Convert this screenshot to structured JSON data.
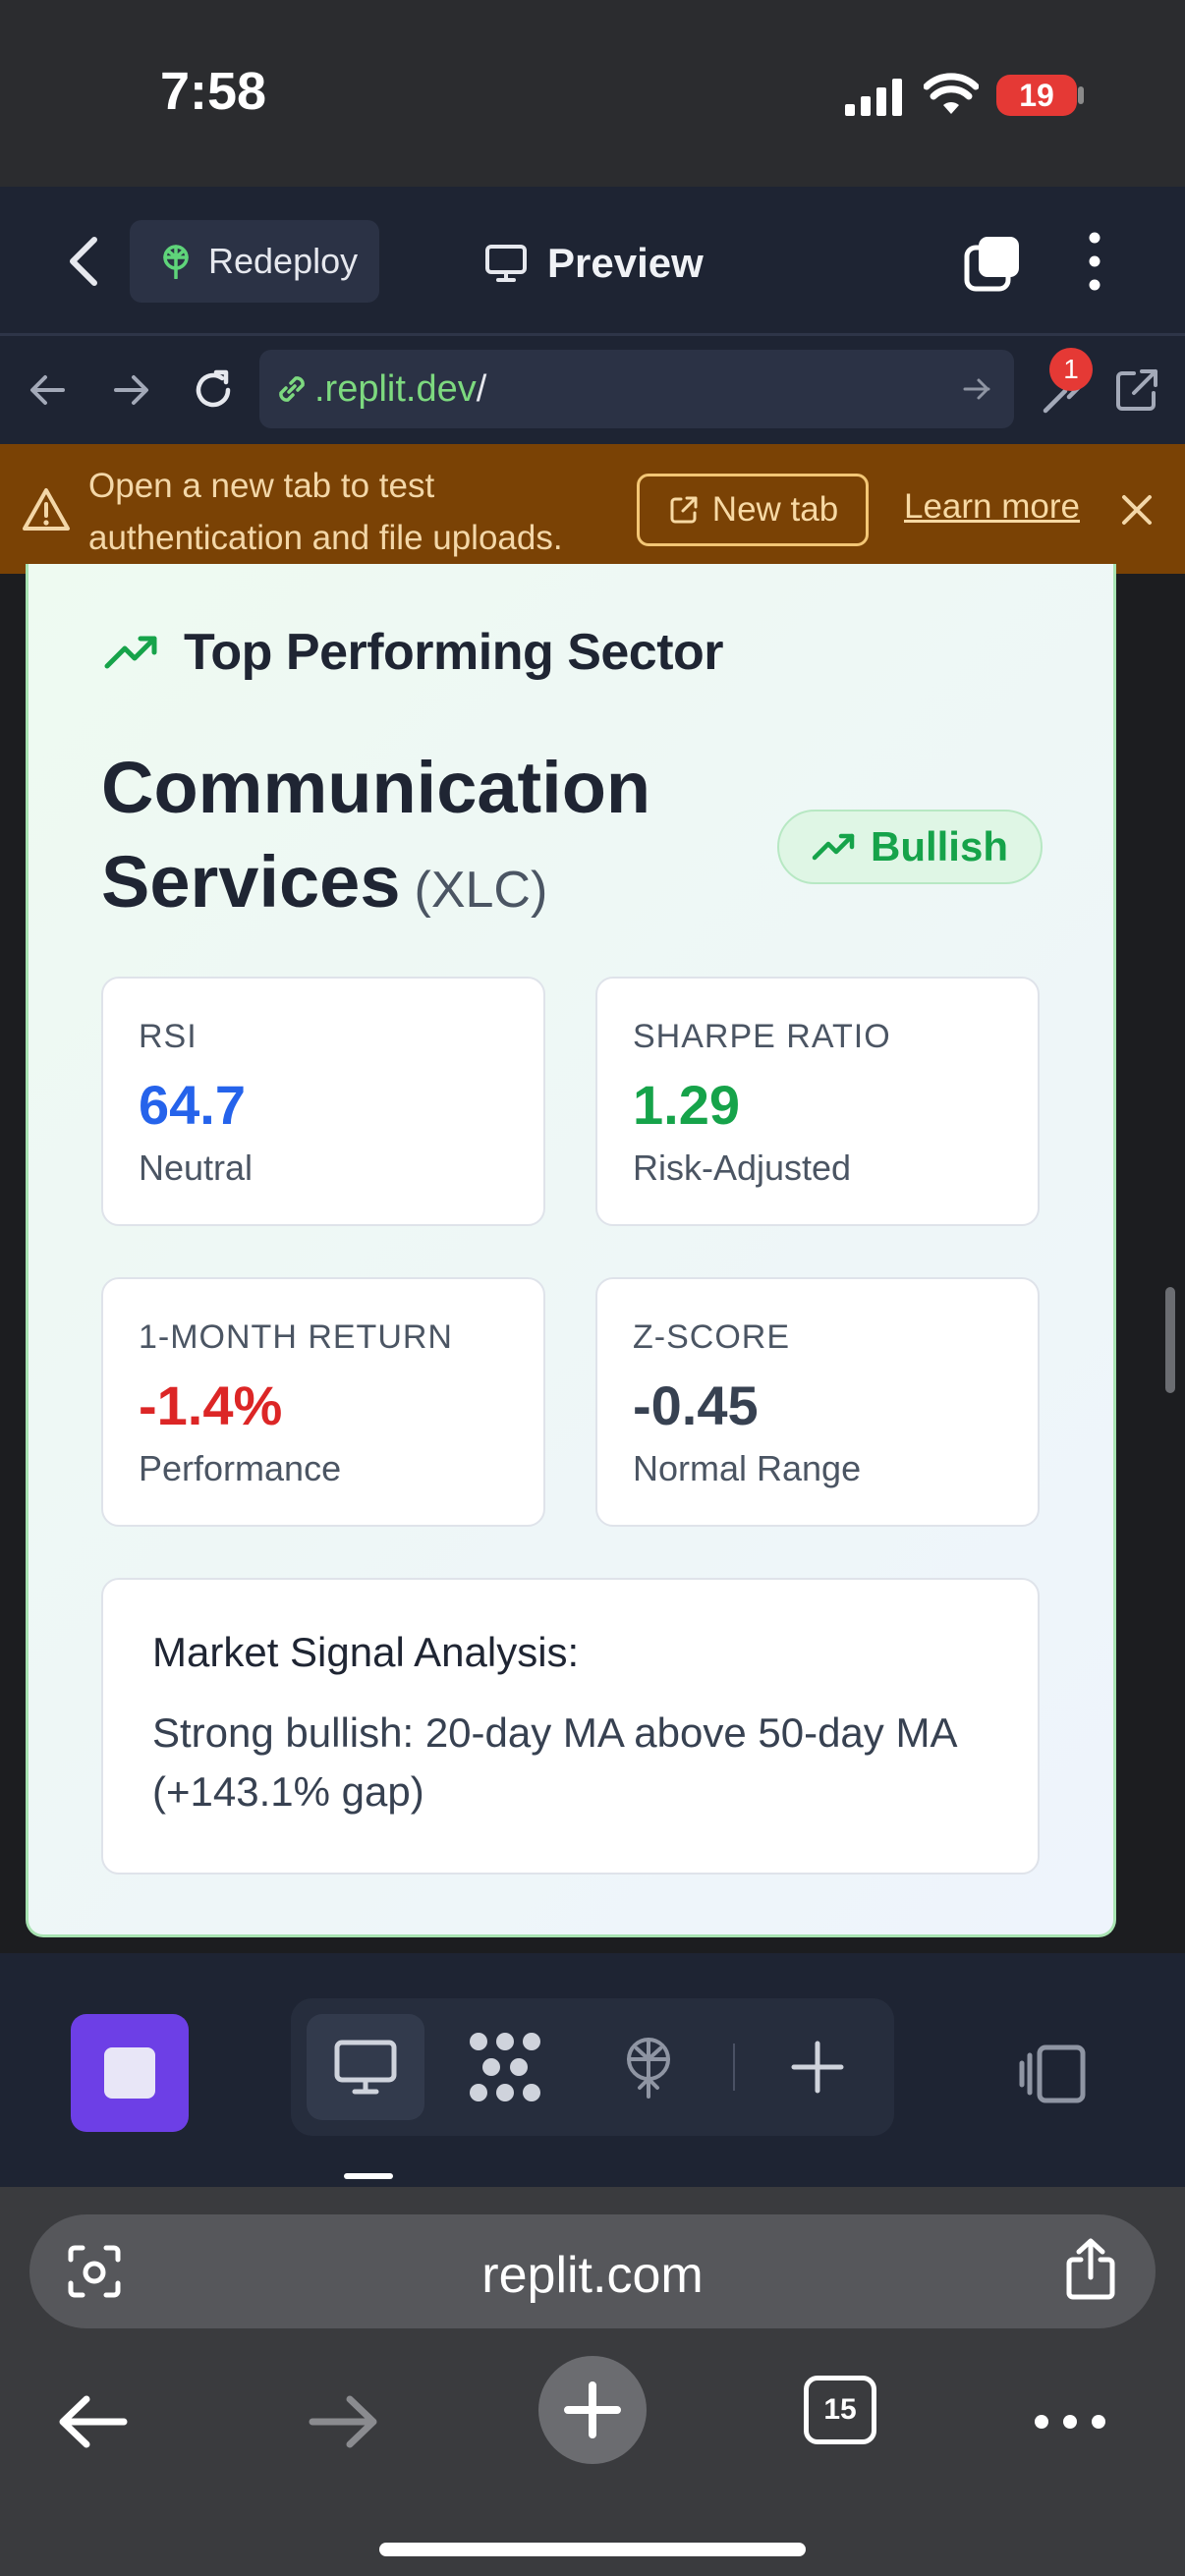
{
  "status_bar": {
    "time": "7:58",
    "battery": "19"
  },
  "header": {
    "redeploy_label": "Redeploy",
    "preview_label": "Preview"
  },
  "url_bar": {
    "host": ".replit.dev",
    "path": "/",
    "devtools_badge": "1"
  },
  "banner": {
    "message": "Open a new tab to test authentication and file uploads.",
    "new_tab_label": "New tab",
    "learn_more_label": "Learn more"
  },
  "sector": {
    "heading": "Top Performing Sector",
    "name": "Communication Services",
    "ticker": "(XLC)",
    "signal": "Bullish",
    "metrics": [
      {
        "label": "RSI",
        "value": "64.7",
        "sub": "Neutral",
        "color": "#2563eb"
      },
      {
        "label": "SHARPE RATIO",
        "value": "1.29",
        "sub": "Risk-Adjusted",
        "color": "#16a34a"
      },
      {
        "label": "1-MONTH RETURN",
        "value": "-1.4%",
        "sub": "Performance",
        "color": "#dc2626"
      },
      {
        "label": "Z-SCORE",
        "value": "-0.45",
        "sub": "Normal Range",
        "color": "#374151"
      }
    ],
    "analysis_heading": "Market Signal Analysis:",
    "analysis_body": "Strong bullish: 20-day MA above 50-day MA (+143.1% gap)"
  },
  "toolbar": {
    "icons": [
      "stop-icon",
      "desktop-icon",
      "apps-icon",
      "deploy-icon",
      "add-icon",
      "panel-icon"
    ]
  },
  "browser": {
    "address": "replit.com",
    "tab_count": "15"
  }
}
